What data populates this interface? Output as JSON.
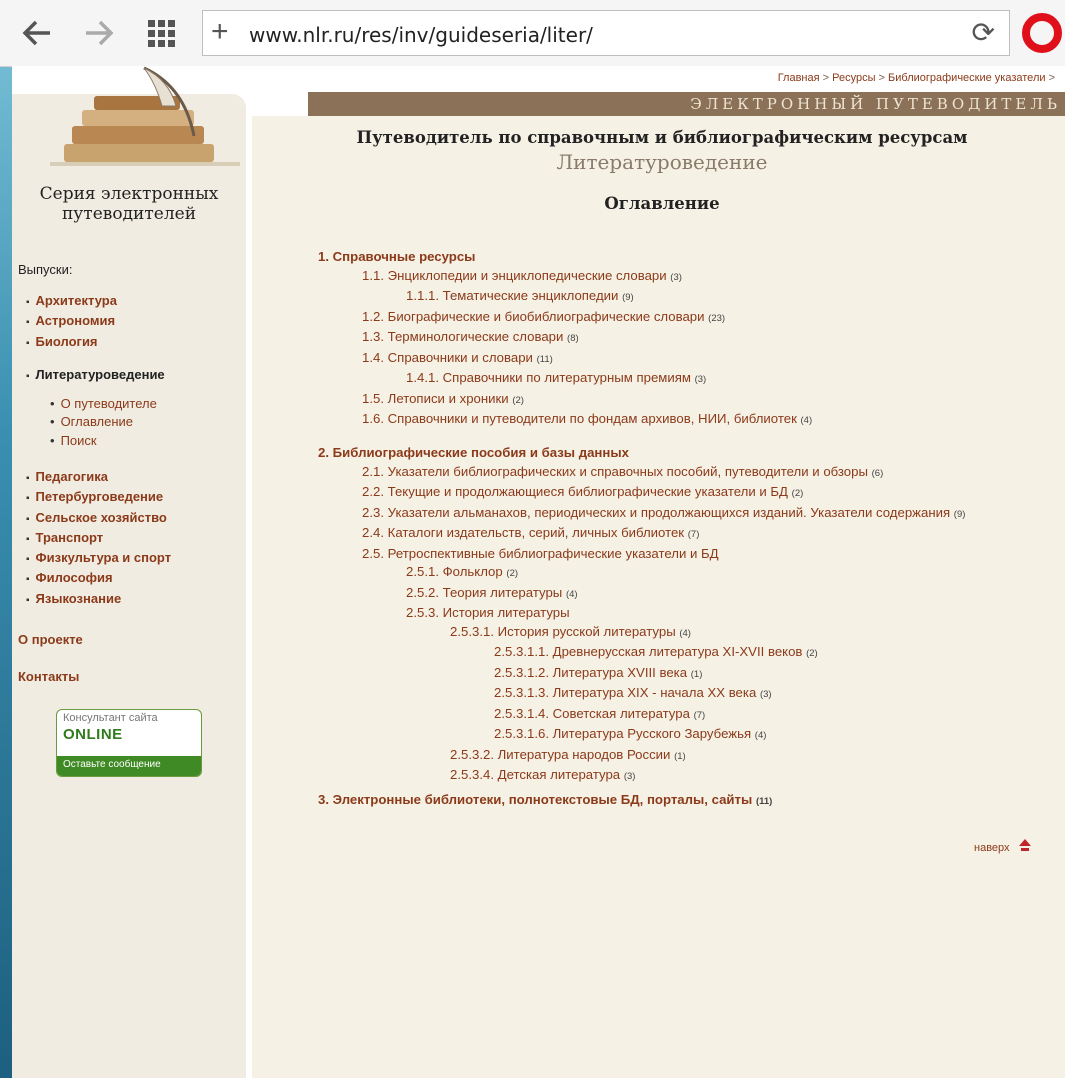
{
  "browser": {
    "url": "www.nlr.ru/res/inv/guideseria/liter/",
    "back_icon": "arrow-left-icon",
    "forward_icon": "arrow-right-icon",
    "grid_icon": "grid-icon",
    "plus_icon": "plus-icon",
    "reload_icon": "reload-icon"
  },
  "breadcrumb": {
    "home": "Главная",
    "sep": " > ",
    "resources": "Ресурсы",
    "bib": "Библиографические указатели",
    "tail": " >"
  },
  "banner": "ЭЛЕКТРОННЫЙ ПУТЕВОДИТЕЛЬ",
  "sidebar": {
    "series_title": "Серия электронных путеводителей",
    "issues_heading": "Выпуски:",
    "group1": [
      "Архитектура",
      "Астрономия",
      "Биология"
    ],
    "current": "Литературоведение",
    "sub": [
      "О путеводителе",
      "Оглавление",
      "Поиск"
    ],
    "group2": [
      "Педагогика",
      "Петербурговедение",
      "Сельское хозяйство",
      "Транспорт",
      "Физкультура и спорт",
      "Философия",
      "Языкознание"
    ],
    "about": "О проекте",
    "contacts": "Контакты",
    "consult": {
      "line1": "Консультант сайта",
      "line2": "ONLINE",
      "line3": "Оставьте сообщение"
    }
  },
  "main": {
    "title": "Путеводитель по справочным и библиографическим ресурсам",
    "subtitle": "Литературоведение",
    "toc_heading": "Оглавление",
    "to_top": "наверх"
  },
  "toc1": [
    {
      "t": "1. Справочные ресурсы",
      "n": "",
      "lvl": "h"
    },
    {
      "t": "1.1. Энциклопедии и энциклопедические словари",
      "n": "(3)",
      "lvl": "l1"
    },
    {
      "t": "1.1.1. Тематические энциклопедии",
      "n": "(9)",
      "lvl": "l2"
    },
    {
      "t": "1.2. Биографические и биобиблиографические словари",
      "n": "(23)",
      "lvl": "l1"
    },
    {
      "t": "1.3. Терминологические словари",
      "n": "(8)",
      "lvl": "l1"
    },
    {
      "t": "1.4. Справочники и словари",
      "n": "(11)",
      "lvl": "l1"
    },
    {
      "t": "1.4.1. Справочники по литературным премиям",
      "n": "(3)",
      "lvl": "l2"
    },
    {
      "t": "1.5. Летописи и хроники",
      "n": "(2)",
      "lvl": "l1"
    },
    {
      "t": "1.6. Справочники и путеводители по фондам архивов, НИИ, библиотек",
      "n": "(4)",
      "lvl": "l1"
    }
  ],
  "toc2": [
    {
      "t": "2. Библиографические пособия и базы данных",
      "n": "",
      "lvl": "h"
    },
    {
      "t": "2.1. Указатели библиографических и справочных пособий, путеводители и обзоры",
      "n": "(6)",
      "lvl": "l1"
    },
    {
      "t": "2.2. Текущие и продолжающиеся библиографические указатели и БД",
      "n": "(2)",
      "lvl": "l1"
    },
    {
      "t": "2.3. Указатели альманахов, периодических и продолжающихся изданий. Указатели содержания",
      "n": "(9)",
      "lvl": "l1"
    },
    {
      "t": "2.4. Каталоги издательств, серий, личных библиотек",
      "n": "(7)",
      "lvl": "l1"
    },
    {
      "t": "2.5. Ретроспективные библиографические указатели и БД",
      "n": "",
      "lvl": "l1"
    },
    {
      "t": "2.5.1. Фольклор",
      "n": "(2)",
      "lvl": "l2"
    },
    {
      "t": "2.5.2. Теория литературы",
      "n": "(4)",
      "lvl": "l2"
    },
    {
      "t": "2.5.3. История литературы",
      "n": "",
      "lvl": "l2"
    },
    {
      "t": "2.5.3.1. История русской литературы",
      "n": "(4)",
      "lvl": "l3"
    },
    {
      "t": "2.5.3.1.1. Древнерусская литература XI-XVII веков",
      "n": "(2)",
      "lvl": "l4"
    },
    {
      "t": "2.5.3.1.2. Литература XVIII века",
      "n": "(1)",
      "lvl": "l4"
    },
    {
      "t": "2.5.3.1.3. Литература XIX - начала XX века",
      "n": "(3)",
      "lvl": "l4"
    },
    {
      "t": "2.5.3.1.4. Советская литература",
      "n": "(7)",
      "lvl": "l4"
    },
    {
      "t": "2.5.3.1.6. Литература Русского Зарубежья",
      "n": "(4)",
      "lvl": "l4"
    },
    {
      "t": "2.5.3.2. Литература народов России",
      "n": "(1)",
      "lvl": "l3"
    },
    {
      "t": "2.5.3.4. Детская литература",
      "n": "(3)",
      "lvl": "l3"
    }
  ],
  "toc3": [
    {
      "t": "3. Электронные библиотеки, полнотекстовые БД, порталы, сайты",
      "n": "(11)",
      "lvl": "h"
    }
  ]
}
